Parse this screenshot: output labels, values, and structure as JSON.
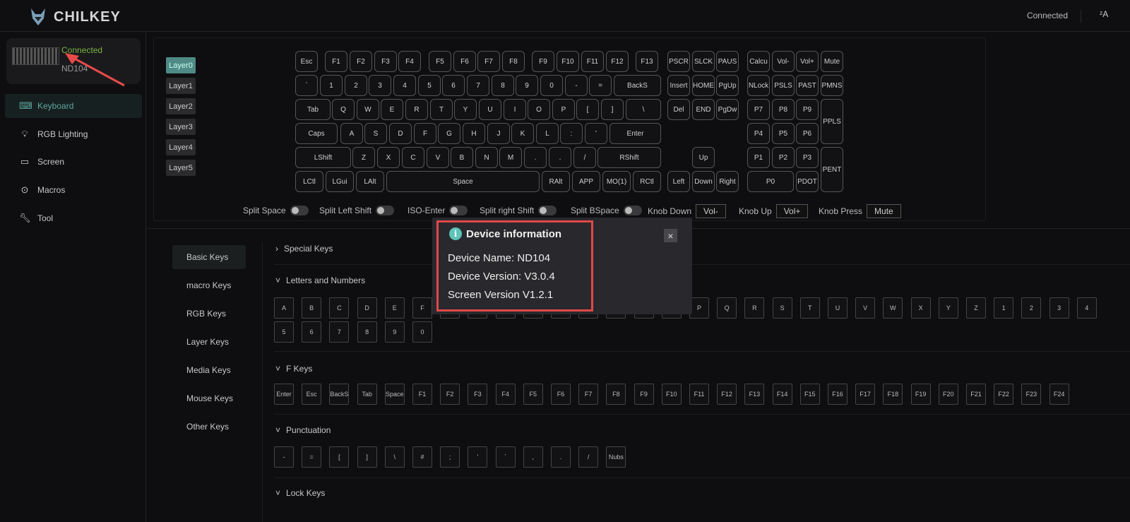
{
  "app": {
    "brand": "CHILKEY",
    "status": "Connected",
    "language_icon": "translate-icon"
  },
  "device": {
    "status": "Connected",
    "name": "ND104"
  },
  "nav": [
    {
      "label": "Keyboard",
      "icon": "keyboard-icon"
    },
    {
      "label": "RGB Lighting",
      "icon": "bulb-icon"
    },
    {
      "label": "Screen",
      "icon": "screen-icon"
    },
    {
      "label": "Macros",
      "icon": "macro-icon"
    },
    {
      "label": "Tool",
      "icon": "wrench-icon"
    }
  ],
  "layers": [
    "Layer0",
    "Layer1",
    "Layer2",
    "Layer3",
    "Layer4",
    "Layer5"
  ],
  "keyboard": {
    "rows": [
      [
        "Esc",
        "F1",
        "F2",
        "F3",
        "F4",
        "F5",
        "F6",
        "F7",
        "F8",
        "F9",
        "F10",
        "F11",
        "F12",
        "F13",
        "PSCR",
        "SLCK",
        "PAUS",
        "Calcu",
        "Vol-",
        "Vol+",
        "Mute"
      ],
      [
        "`",
        "1",
        "2",
        "3",
        "4",
        "5",
        "6",
        "7",
        "8",
        "9",
        "0",
        "-",
        "=",
        "BackS",
        "Insert",
        "HOME",
        "PgUp",
        "NLock",
        "PSLS",
        "PAST",
        "PMNS"
      ],
      [
        "Tab",
        "Q",
        "W",
        "E",
        "R",
        "T",
        "Y",
        "U",
        "I",
        "O",
        "P",
        "[",
        "]",
        "\\",
        "Del",
        "END",
        "PgDw",
        "P7",
        "P8",
        "P9",
        "PPLS"
      ],
      [
        "Caps",
        "A",
        "S",
        "D",
        "F",
        "G",
        "H",
        "J",
        "K",
        "L",
        ":",
        "'",
        "Enter",
        "P4",
        "P5",
        "P6"
      ],
      [
        "LShift",
        "Z",
        "X",
        "C",
        "V",
        "B",
        "N",
        "M",
        ".",
        ".",
        "/",
        "RShift",
        "Up",
        "P1",
        "P2",
        "P3",
        "PENT"
      ],
      [
        "LCtl",
        "LGui",
        "LAlt",
        "Space",
        "RAlt",
        "APP",
        "MO(1)",
        "RCtl",
        "Left",
        "Down",
        "Right",
        "P0",
        "PDOT"
      ]
    ]
  },
  "options": {
    "toggles": [
      {
        "label": "Split Space",
        "on": false
      },
      {
        "label": "Split Left Shift",
        "on": false
      },
      {
        "label": "ISO-Enter",
        "on": false
      },
      {
        "label": "Split right Shift",
        "on": false
      },
      {
        "label": "Split BSpace",
        "on": false
      }
    ],
    "knobs": [
      {
        "label": "Knob Down",
        "value": "Vol-"
      },
      {
        "label": "Knob Up",
        "value": "Vol+"
      },
      {
        "label": "Knob Press",
        "value": "Mute"
      }
    ]
  },
  "categories": [
    "Basic Keys",
    "macro Keys",
    "RGB Keys",
    "Layer Keys",
    "Media Keys",
    "Mouse Keys",
    "Other Keys"
  ],
  "sections": [
    {
      "title": "Special Keys",
      "expanded": false,
      "keys": []
    },
    {
      "title": "Letters and Numbers",
      "expanded": true,
      "keys": [
        "A",
        "B",
        "C",
        "D",
        "E",
        "F",
        "G",
        "H",
        "I",
        "J",
        "K",
        "L",
        "M",
        "N",
        "O",
        "P",
        "Q",
        "R",
        "S",
        "T",
        "U",
        "V",
        "W",
        "X",
        "Y",
        "Z",
        "1",
        "2",
        "3",
        "4",
        "5",
        "6",
        "7",
        "8",
        "9",
        "0"
      ]
    },
    {
      "title": "F Keys",
      "expanded": true,
      "keys": [
        "Enter",
        "Esc",
        "BackS",
        "Tab",
        "Space",
        "F1",
        "F2",
        "F3",
        "F4",
        "F5",
        "F6",
        "F7",
        "F8",
        "F9",
        "F10",
        "F11",
        "F12",
        "F13",
        "F14",
        "F15",
        "F16",
        "F17",
        "F18",
        "F19",
        "F20",
        "F21",
        "F22",
        "F23",
        "F24"
      ]
    },
    {
      "title": "Punctuation",
      "expanded": true,
      "keys": [
        "-",
        "=",
        "[",
        "]",
        "\\",
        "#",
        ";",
        "'",
        "`",
        ",",
        ".",
        "/",
        "Nubs"
      ]
    },
    {
      "title": "Lock Keys",
      "expanded": true,
      "keys": []
    }
  ],
  "popup": {
    "title": "Device information",
    "lines": [
      "Device Name: ND104",
      "Device Version: V3.0.4",
      "Screen Version V1.2.1"
    ],
    "close": "×"
  },
  "colors": {
    "accent": "#4f8a86",
    "connected": "#7cb342",
    "highlight_box": "#e04848"
  }
}
